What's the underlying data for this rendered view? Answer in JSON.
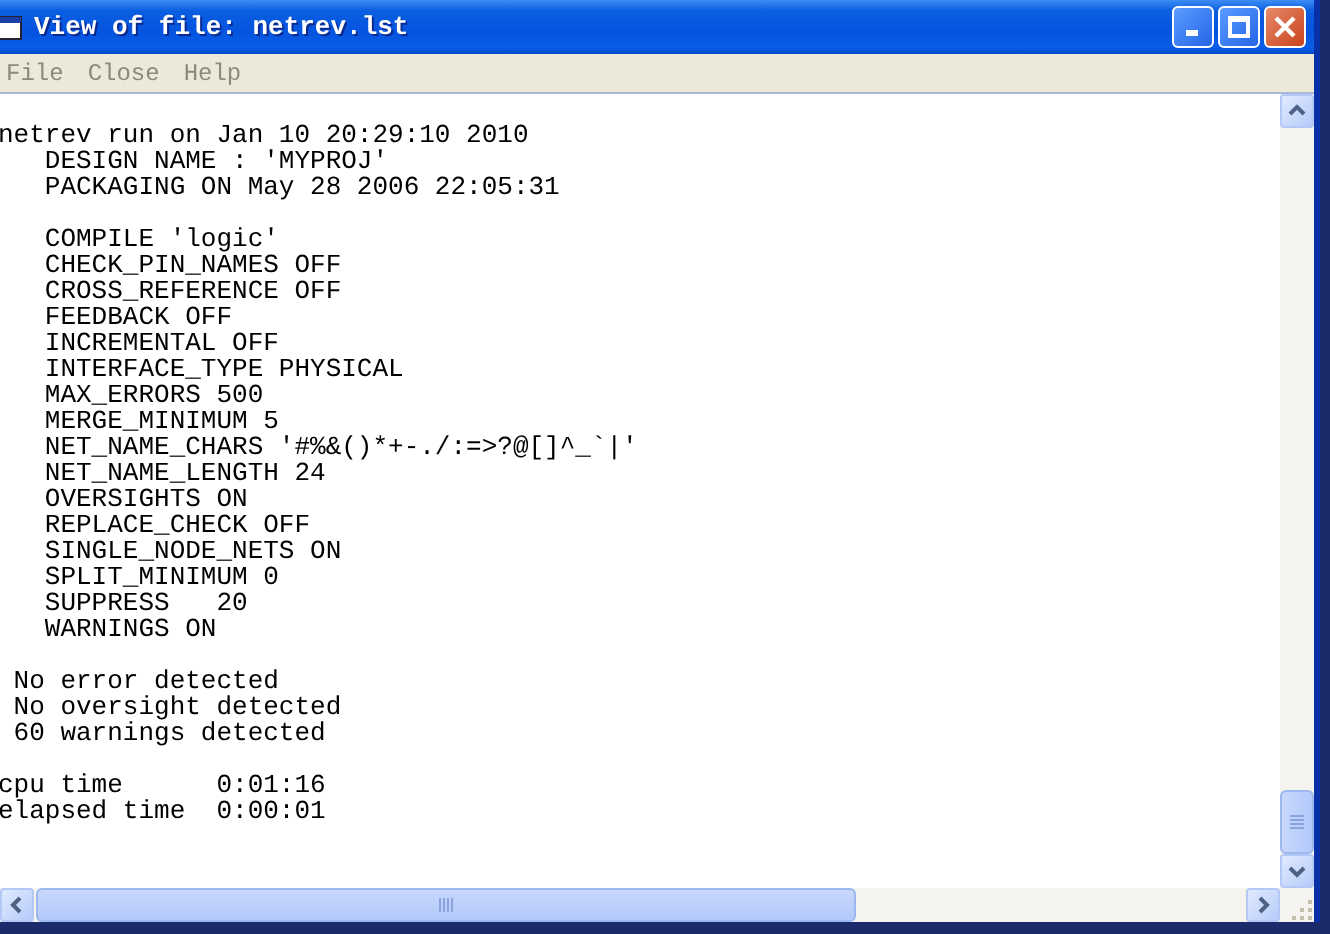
{
  "window": {
    "title": "View of file: netrev.lst"
  },
  "menu": [
    {
      "label": "File"
    },
    {
      "label": "Close"
    },
    {
      "label": "Help"
    }
  ],
  "listing": [
    [
      "netrev run on Jan 10 20:29:10 2010",
      "   DESIGN NAME : 'MYPROJ'",
      "   PACKAGING ON May 28 2006 22:05:31"
    ],
    [
      "   COMPILE 'logic'",
      "   CHECK_PIN_NAMES OFF",
      "   CROSS_REFERENCE OFF",
      "   FEEDBACK OFF",
      "   INCREMENTAL OFF",
      "   INTERFACE_TYPE PHYSICAL",
      "   MAX_ERRORS 500",
      "   MERGE_MINIMUM 5",
      "   NET_NAME_CHARS '#%&()*+-./:=>?@[]^_`|'",
      "   NET_NAME_LENGTH 24",
      "   OVERSIGHTS ON",
      "   REPLACE_CHECK OFF",
      "   SINGLE_NODE_NETS ON",
      "   SPLIT_MINIMUM 0",
      "   SUPPRESS   20",
      "   WARNINGS ON"
    ],
    [
      " No error detected",
      " No oversight detected",
      " 60 warnings detected"
    ],
    [
      "cpu time      0:01:16",
      "elapsed time  0:00:01"
    ]
  ]
}
